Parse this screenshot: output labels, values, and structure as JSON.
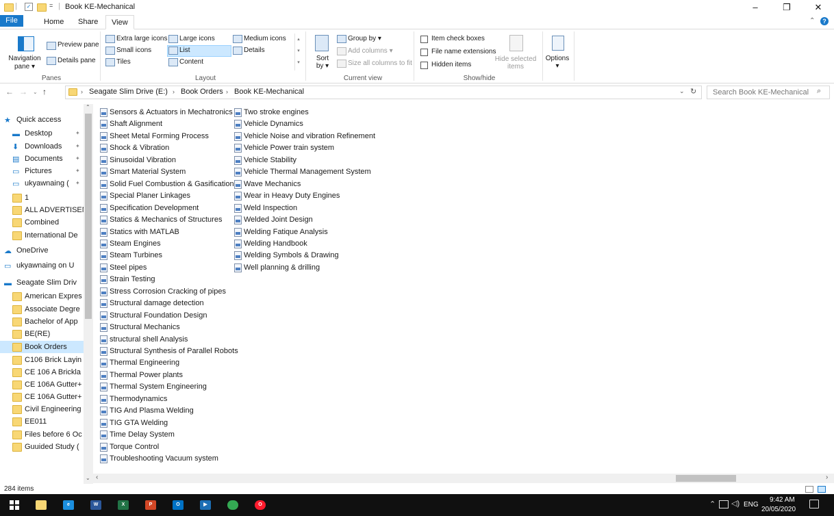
{
  "window": {
    "title": "Book KE-Mechanical",
    "controls": {
      "minimize": "–",
      "maximize": "❐",
      "close": "✕"
    }
  },
  "tabs": [
    {
      "label": "File"
    },
    {
      "label": "Home"
    },
    {
      "label": "Share"
    },
    {
      "label": "View"
    }
  ],
  "ribbon": {
    "panes": {
      "navigation_pane": "Navigation\npane ▾",
      "preview_pane": "Preview pane",
      "details_pane": "Details pane",
      "group": "Panes"
    },
    "layout": {
      "extra_large": "Extra large icons",
      "large": "Large icons",
      "medium": "Medium icons",
      "small": "Small icons",
      "list": "List",
      "details": "Details",
      "tiles": "Tiles",
      "content": "Content",
      "group": "Layout"
    },
    "current_view": {
      "sort_by": "Sort\nby ▾",
      "group_by": "Group by ▾",
      "add_columns": "Add columns ▾",
      "size_all": "Size all columns to fit",
      "group": "Current view"
    },
    "show_hide": {
      "item_check_boxes": "Item check boxes",
      "file_name_extensions": "File name extensions",
      "hidden_items": "Hidden items",
      "hide_selected": "Hide selected\nitems",
      "group": "Show/hide"
    },
    "options": "Options\n▾"
  },
  "address": {
    "breadcrumb": [
      "Seagate Slim Drive (E:)",
      "Book Orders",
      "Book KE-Mechanical"
    ],
    "search_placeholder": "Search Book KE-Mechanical"
  },
  "nav_pane": [
    {
      "label": "Quick access",
      "icon": "star-icon",
      "color": "#1979ca"
    },
    {
      "label": "Desktop",
      "icon": "desktop-icon",
      "pinned": true
    },
    {
      "label": "Downloads",
      "icon": "download-icon",
      "pinned": true
    },
    {
      "label": "Documents",
      "icon": "document-icon",
      "pinned": true
    },
    {
      "label": "Pictures",
      "icon": "picture-icon",
      "pinned": true
    },
    {
      "label": "ukyawnaing (",
      "icon": "monitor-icon",
      "pinned": true
    },
    {
      "label": "1",
      "icon": "folder-icon"
    },
    {
      "label": "ALL ADVERTISEN",
      "icon": "folder-icon"
    },
    {
      "label": "Combined",
      "icon": "folder-icon"
    },
    {
      "label": "International De",
      "icon": "folder-icon"
    },
    {
      "label": "OneDrive",
      "icon": "cloud-icon"
    },
    {
      "label": "ukyawnaing on U",
      "icon": "monitor-icon"
    },
    {
      "label": "Seagate Slim Driv",
      "icon": "drive-icon"
    },
    {
      "label": "American Expres",
      "icon": "folder-icon"
    },
    {
      "label": "Associate Degre",
      "icon": "folder-icon"
    },
    {
      "label": "Bachelor of App",
      "icon": "folder-icon"
    },
    {
      "label": "BE(RE)",
      "icon": "folder-icon"
    },
    {
      "label": "Book Orders",
      "icon": "folder-icon",
      "selected": true
    },
    {
      "label": "C106 Brick Layin",
      "icon": "folder-icon"
    },
    {
      "label": "CE 106 A Brickla",
      "icon": "folder-icon"
    },
    {
      "label": "CE 106A Gutter+",
      "icon": "folder-icon"
    },
    {
      "label": "CE 106A Gutter+",
      "icon": "folder-icon"
    },
    {
      "label": "Civil Engineering",
      "icon": "folder-icon"
    },
    {
      "label": "EE011",
      "icon": "folder-icon"
    },
    {
      "label": "Files before 6 Oc",
      "icon": "folder-icon"
    },
    {
      "label": "Guuided Study (",
      "icon": "folder-icon"
    }
  ],
  "files_col1": [
    "Sensors & Actuators in Mechatronics",
    "Shaft Alignment",
    "Sheet Metal Forming Process",
    "Shock & Vibration",
    "Sinusoidal Vibration",
    "Smart Material System",
    "Solid Fuel Combustion & Gasification",
    "Special Planer Linkages",
    "Specification Development",
    "Statics & Mechanics of Structures",
    "Statics with MATLAB",
    "Steam Engines",
    "Steam Turbines",
    "Steel pipes",
    "Strain Testing",
    "Stress Corrosion Cracking of pipes",
    "Structural damage detection",
    "Structural Foundation Design",
    "Structural Mechanics",
    "structural shell Analysis",
    "Structural Synthesis of Parallel Robots",
    "Thermal Engineering",
    "Thermal Power plants",
    "Thermal System Engineering",
    "Thermodynamics",
    "TIG And Plasma Welding",
    "TIG GTA Welding",
    "Time Delay System",
    "Torque Control",
    "Troubleshooting Vacuum system"
  ],
  "files_col2": [
    "Two stroke engines",
    "Vehicle Dynamics",
    "Vehicle Noise and vibration Refinement",
    "Vehicle Power train system",
    "Vehicle Stability",
    "Vehicle Thermal Management System",
    "Wave Mechanics",
    "Wear in Heavy Duty Engines",
    "Weld Inspection",
    "Welded Joint Design",
    "Welding Fatique Analysis",
    "Welding Handbook",
    "Welding Symbols & Drawing",
    "Well planning & drilling"
  ],
  "status": {
    "count": "284 items"
  },
  "taskbar": {
    "lang": "ENG",
    "time": "9:42 AM",
    "date": "20/05/2020",
    "apps": [
      {
        "name": "file-explorer-icon",
        "glyph": "",
        "color": "#f8d775"
      },
      {
        "name": "internet-explorer-icon",
        "glyph": "e",
        "color": "#1b8fe0"
      },
      {
        "name": "word-icon",
        "glyph": "W",
        "color": "#2b579a"
      },
      {
        "name": "excel-icon",
        "glyph": "X",
        "color": "#217346"
      },
      {
        "name": "powerpoint-icon",
        "glyph": "P",
        "color": "#d24726"
      },
      {
        "name": "outlook-icon",
        "glyph": "O",
        "color": "#0072c6"
      },
      {
        "name": "media-player-icon",
        "glyph": "▶",
        "color": "#1c6fb5"
      },
      {
        "name": "chrome-icon",
        "glyph": "",
        "color": "#34a853"
      },
      {
        "name": "opera-icon",
        "glyph": "O",
        "color": "#ff1b2d"
      }
    ]
  }
}
